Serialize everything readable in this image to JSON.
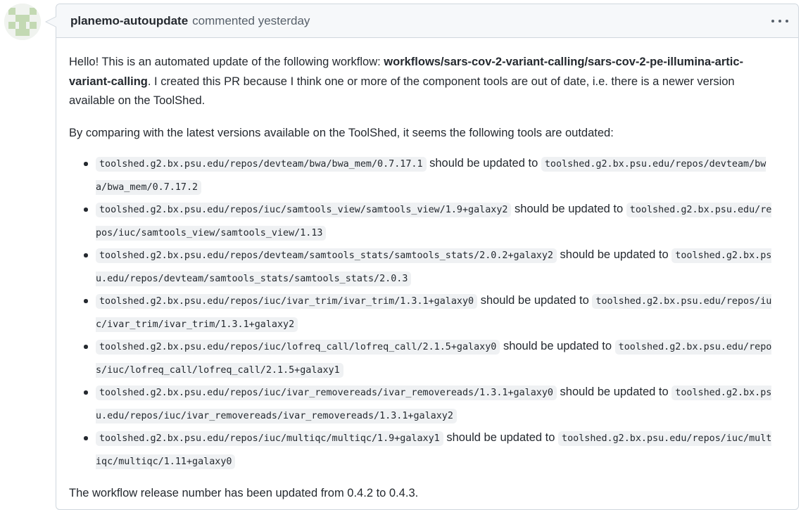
{
  "comment": {
    "author": "planemo-autoupdate",
    "action": "commented yesterday",
    "intro": {
      "prefix": "Hello! This is an automated update of the following workflow: ",
      "workflow": "workflows/sars-cov-2-variant-calling/sars-cov-2-pe-illumina-artic-variant-calling",
      "suffix": ". I created this PR because I think one or more of the component tools are out of date, i.e. there is a newer version available on the ToolShed."
    },
    "lead": "By comparing with the latest versions available on the ToolShed, it seems the following tools are outdated:",
    "connector": "should be updated to",
    "updates": [
      {
        "from": "toolshed.g2.bx.psu.edu/repos/devteam/bwa/bwa_mem/0.7.17.1",
        "to": "toolshed.g2.bx.psu.edu/repos/devteam/bwa/bwa_mem/0.7.17.2"
      },
      {
        "from": "toolshed.g2.bx.psu.edu/repos/iuc/samtools_view/samtools_view/1.9+galaxy2",
        "to": "toolshed.g2.bx.psu.edu/repos/iuc/samtools_view/samtools_view/1.13"
      },
      {
        "from": "toolshed.g2.bx.psu.edu/repos/devteam/samtools_stats/samtools_stats/2.0.2+galaxy2",
        "to": "toolshed.g2.bx.psu.edu/repos/devteam/samtools_stats/samtools_stats/2.0.3"
      },
      {
        "from": "toolshed.g2.bx.psu.edu/repos/iuc/ivar_trim/ivar_trim/1.3.1+galaxy0",
        "to": "toolshed.g2.bx.psu.edu/repos/iuc/ivar_trim/ivar_trim/1.3.1+galaxy2"
      },
      {
        "from": "toolshed.g2.bx.psu.edu/repos/iuc/lofreq_call/lofreq_call/2.1.5+galaxy0",
        "to": "toolshed.g2.bx.psu.edu/repos/iuc/lofreq_call/lofreq_call/2.1.5+galaxy1"
      },
      {
        "from": "toolshed.g2.bx.psu.edu/repos/iuc/ivar_removereads/ivar_removereads/1.3.1+galaxy0",
        "to": "toolshed.g2.bx.psu.edu/repos/iuc/ivar_removereads/ivar_removereads/1.3.1+galaxy2"
      },
      {
        "from": "toolshed.g2.bx.psu.edu/repos/iuc/multiqc/multiqc/1.9+galaxy1",
        "to": "toolshed.g2.bx.psu.edu/repos/iuc/multiqc/multiqc/1.11+galaxy0"
      }
    ],
    "footer": "The workflow release number has been updated from 0.4.2 to 0.4.3."
  },
  "icons": {
    "avatar": "identicon-avatar",
    "menu": "kebab-menu-icon"
  },
  "colors": {
    "avatar_fill": "#c3d9b3",
    "border": "#d0d7de",
    "header_bg": "#f6f8fa",
    "code_bg": "#eff1f3",
    "muted_text": "#57606a"
  }
}
